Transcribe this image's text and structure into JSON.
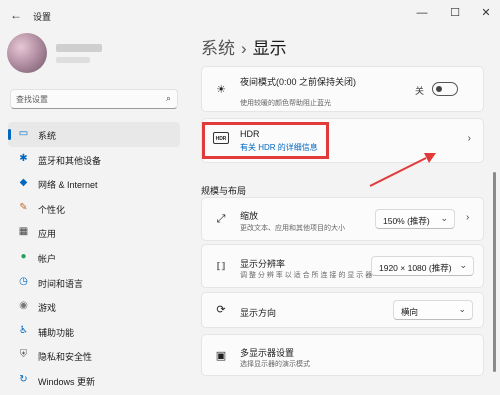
{
  "window": {
    "title": "设置",
    "back_icon": "←",
    "min_icon": "—",
    "max_icon": "☐",
    "close_icon": "✕"
  },
  "search": {
    "placeholder": "查找设置",
    "icon": "⌕"
  },
  "nav": {
    "items": [
      {
        "label": "系统",
        "icon": "▭",
        "color": "#0067c0",
        "active": true
      },
      {
        "label": "蓝牙和其他设备",
        "icon": "✱",
        "color": "#0067c0"
      },
      {
        "label": "网络 & Internet",
        "icon": "◆",
        "color": "#0067c0"
      },
      {
        "label": "个性化",
        "icon": "✎",
        "color": "#c0662b"
      },
      {
        "label": "应用",
        "icon": "▦",
        "color": "#444444"
      },
      {
        "label": "帐户",
        "icon": "●",
        "color": "#2aa05a"
      },
      {
        "label": "时间和语言",
        "icon": "◷",
        "color": "#0067c0"
      },
      {
        "label": "游戏",
        "icon": "◉",
        "color": "#777777"
      },
      {
        "label": "辅助功能",
        "icon": "♿",
        "color": "#0067c0"
      },
      {
        "label": "隐私和安全性",
        "icon": "⛨",
        "color": "#666666"
      },
      {
        "label": "Windows 更新",
        "icon": "↻",
        "color": "#0067c0"
      }
    ]
  },
  "breadcrumb": {
    "parent": "系统",
    "separator": "›",
    "current": "显示"
  },
  "night_light": {
    "title": "夜间模式(0:00 之前保持关闭)",
    "subtitle": "使用较暖的颜色帮助阻止蓝光",
    "icon": "☀",
    "toggle_label": "关",
    "toggle_on": false
  },
  "hdr": {
    "title": "HDR",
    "subtitle": "有关 HDR 的详细信息",
    "icon": "HDR",
    "chevron": "›"
  },
  "section_title": "规模与布局",
  "scale": {
    "title": "缩放",
    "subtitle": "更改文本、应用和其他项目的大小",
    "icon": "⤢",
    "value": "150% (推荐)",
    "chevron": "⌄"
  },
  "resolution": {
    "title": "显示分辨率",
    "subtitle": "调 整 分 辨 率 以 适 合 所 连 接 的 显 示 器",
    "icon": "⟦⟧",
    "value": "1920 × 1080 (推荐)",
    "chevron": "⌄"
  },
  "orientation": {
    "title": "显示方向",
    "icon": "⟳",
    "value": "横向",
    "chevron": "⌄"
  },
  "multi_display": {
    "title": "多显示器设置",
    "subtitle": "选择显示器的演示模式",
    "icon": "▣"
  },
  "colors": {
    "accent": "#0067c0",
    "highlight": "#e03a3a"
  }
}
